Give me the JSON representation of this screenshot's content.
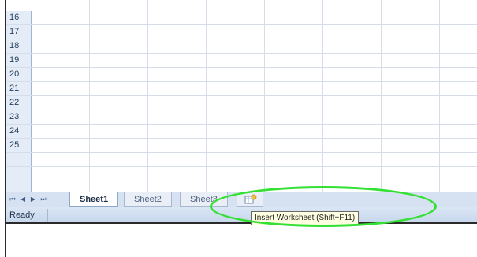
{
  "rows": [
    "16",
    "17",
    "18",
    "19",
    "20",
    "21",
    "22",
    "23",
    "24",
    "25"
  ],
  "tab_navigation": [
    "⏮",
    "◀",
    "▶",
    "⏭"
  ],
  "sheet_tabs": [
    {
      "label": "Sheet1",
      "active": true
    },
    {
      "label": "Sheet2",
      "active": false
    },
    {
      "label": "Sheet3",
      "active": false
    }
  ],
  "insert_worksheet": {
    "icon": "insert-worksheet-icon",
    "tooltip": "Insert Worksheet (Shift+F11)"
  },
  "status": {
    "text": "Ready"
  },
  "colors": {
    "header_bg": "#e4ecf7",
    "tabbar_bg": "#d6e2f1",
    "highlight": "#33e033",
    "tooltip_bg": "#ffffe1"
  }
}
